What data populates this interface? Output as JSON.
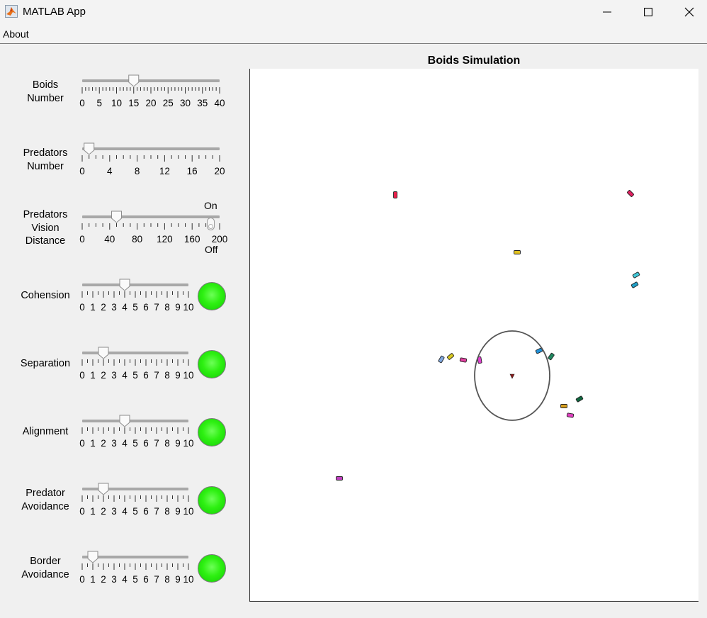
{
  "window": {
    "title": "MATLAB App",
    "icon": "matlab-logo-icon",
    "controls": [
      "minimize-icon",
      "maximize-icon",
      "close-icon"
    ]
  },
  "menu": {
    "items": [
      "About"
    ]
  },
  "controls": [
    {
      "id": "boids-number",
      "label_lines": [
        "Boids",
        "Number"
      ],
      "min": 0,
      "max": 40,
      "value": 15,
      "major_ticks": [
        0,
        5,
        10,
        15,
        20,
        25,
        30,
        35,
        40
      ],
      "tick_labels": [
        "0",
        "5",
        "10",
        "15",
        "20",
        "25",
        "30",
        "35",
        "40"
      ],
      "minor_step": 1
    },
    {
      "id": "predators-number",
      "label_lines": [
        "Predators",
        "Number"
      ],
      "min": 0,
      "max": 20,
      "value": 1,
      "major_ticks": [
        0,
        4,
        8,
        12,
        16,
        20
      ],
      "tick_labels": [
        "0",
        "4",
        "8",
        "12",
        "16",
        "20"
      ],
      "minor_step": 1
    },
    {
      "id": "predators-vision-distance",
      "label_lines": [
        "Predators",
        "Vision",
        "Distance"
      ],
      "min": 0,
      "max": 200,
      "value": 50,
      "major_ticks": [
        0,
        40,
        80,
        120,
        160,
        200
      ],
      "tick_labels": [
        "0",
        "40",
        "80",
        "120",
        "160",
        "200"
      ],
      "minor_step": 10
    },
    {
      "id": "cohension",
      "label_lines": [
        "Cohension"
      ],
      "min": 0,
      "max": 10,
      "value": 4,
      "major_ticks": [
        0,
        1,
        2,
        3,
        4,
        5,
        6,
        7,
        8,
        9,
        10
      ],
      "tick_labels": [
        "0",
        "1",
        "2",
        "3",
        "4",
        "5",
        "6",
        "7",
        "8",
        "9",
        "10"
      ],
      "minor_step": 0.5,
      "lamp": "on"
    },
    {
      "id": "separation",
      "label_lines": [
        "Separation"
      ],
      "min": 0,
      "max": 10,
      "value": 2,
      "major_ticks": [
        0,
        1,
        2,
        3,
        4,
        5,
        6,
        7,
        8,
        9,
        10
      ],
      "tick_labels": [
        "0",
        "1",
        "2",
        "3",
        "4",
        "5",
        "6",
        "7",
        "8",
        "9",
        "10"
      ],
      "minor_step": 0.5,
      "lamp": "on"
    },
    {
      "id": "alignment",
      "label_lines": [
        "Alignment"
      ],
      "min": 0,
      "max": 10,
      "value": 4,
      "major_ticks": [
        0,
        1,
        2,
        3,
        4,
        5,
        6,
        7,
        8,
        9,
        10
      ],
      "tick_labels": [
        "0",
        "1",
        "2",
        "3",
        "4",
        "5",
        "6",
        "7",
        "8",
        "9",
        "10"
      ],
      "minor_step": 0.5,
      "lamp": "on"
    },
    {
      "id": "predator-avoidance",
      "label_lines": [
        "Predator",
        "Avoidance"
      ],
      "min": 0,
      "max": 10,
      "value": 2,
      "major_ticks": [
        0,
        1,
        2,
        3,
        4,
        5,
        6,
        7,
        8,
        9,
        10
      ],
      "tick_labels": [
        "0",
        "1",
        "2",
        "3",
        "4",
        "5",
        "6",
        "7",
        "8",
        "9",
        "10"
      ],
      "minor_step": 0.5,
      "lamp": "on"
    },
    {
      "id": "border-avoidance",
      "label_lines": [
        "Border",
        "Avoidance"
      ],
      "min": 0,
      "max": 10,
      "value": 1,
      "major_ticks": [
        0,
        1,
        2,
        3,
        4,
        5,
        6,
        7,
        8,
        9,
        10
      ],
      "tick_labels": [
        "0",
        "1",
        "2",
        "3",
        "4",
        "5",
        "6",
        "7",
        "8",
        "9",
        "10"
      ],
      "minor_step": 0.5,
      "lamp": "on"
    }
  ],
  "vision_switch": {
    "on_label": "On",
    "off_label": "Off",
    "state": "Off"
  },
  "lamp_color": "#2ef012",
  "plot": {
    "title": "Boids Simulation",
    "background": "#ffffff",
    "predator": {
      "color": "#8b1a1a"
    },
    "vision_circle_color": "#555555",
    "boids": [
      {
        "color": "#e8204a"
      },
      {
        "color": "#e02060"
      },
      {
        "color": "#e0c020"
      },
      {
        "color": "#40c8d8"
      },
      {
        "color": "#20a0c8"
      },
      {
        "color": "#80a8e0"
      },
      {
        "color": "#d8c820"
      },
      {
        "color": "#e040a0"
      },
      {
        "color": "#e040d0"
      },
      {
        "color": "#2090d8"
      },
      {
        "color": "#208860"
      },
      {
        "color": "#d8a020"
      },
      {
        "color": "#106840"
      },
      {
        "color": "#e040c0"
      },
      {
        "color": "#c040c0"
      }
    ]
  }
}
